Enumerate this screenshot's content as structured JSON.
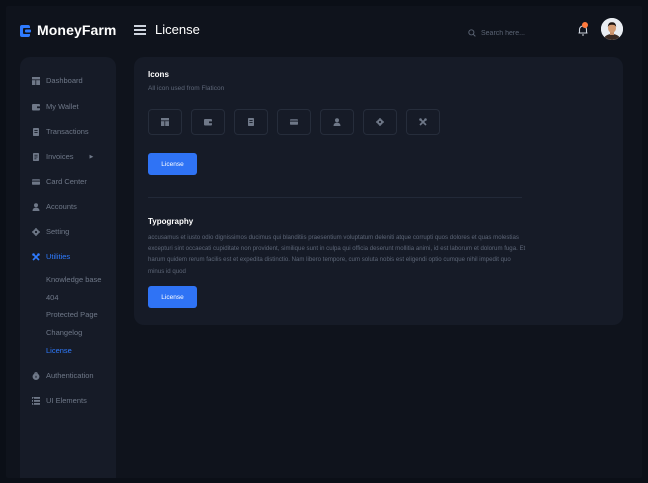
{
  "brand": {
    "name": "MoneyFarm",
    "accent": "#2f7bff"
  },
  "header": {
    "title": "License",
    "search_placeholder": "Search here...",
    "notification_color": "#ff7a3d"
  },
  "sidebar": {
    "items": [
      {
        "label": "Dashboard",
        "icon": "dashboard-icon"
      },
      {
        "label": "My Wallet",
        "icon": "wallet-icon"
      },
      {
        "label": "Transactions",
        "icon": "receipt-icon"
      },
      {
        "label": "Invoices",
        "icon": "invoice-icon"
      },
      {
        "label": "Card Center",
        "icon": "card-icon"
      },
      {
        "label": "Accounts",
        "icon": "user-icon"
      },
      {
        "label": "Setting",
        "icon": "gear-icon"
      },
      {
        "label": "Utilities",
        "icon": "tools-icon"
      },
      {
        "label": "Authentication",
        "icon": "lock-icon"
      },
      {
        "label": "UI Elements",
        "icon": "layers-icon"
      }
    ],
    "sub_items": [
      "Knowledge base",
      "404",
      "Protected Page",
      "Changelog",
      "License"
    ]
  },
  "icons_section": {
    "title": "Icons",
    "subtitle": "All icon used from Flaticon",
    "icons": [
      "dashboard-icon",
      "wallet-icon",
      "receipt-icon",
      "card-icon",
      "user-icon",
      "gear-icon",
      "tools-icon"
    ],
    "button_label": "License"
  },
  "typography_section": {
    "title": "Typography",
    "paragraph": "accusamus et iusto odio dignissimos ducimus qui blanditiis praesentium voluptatum deleniti atque corrupti quos dolores et quas molestias excepturi sint occaecati cupiditate non provident, similique sunt in culpa qui officia deserunt mollitia animi, id est laborum et dolorum fuga. Et harum quidem rerum facilis est et expedita distinctio. Nam libero tempore, cum soluta nobis est eligendi optio cumque nihil impedit quo minus id quod",
    "button_label": "License"
  }
}
